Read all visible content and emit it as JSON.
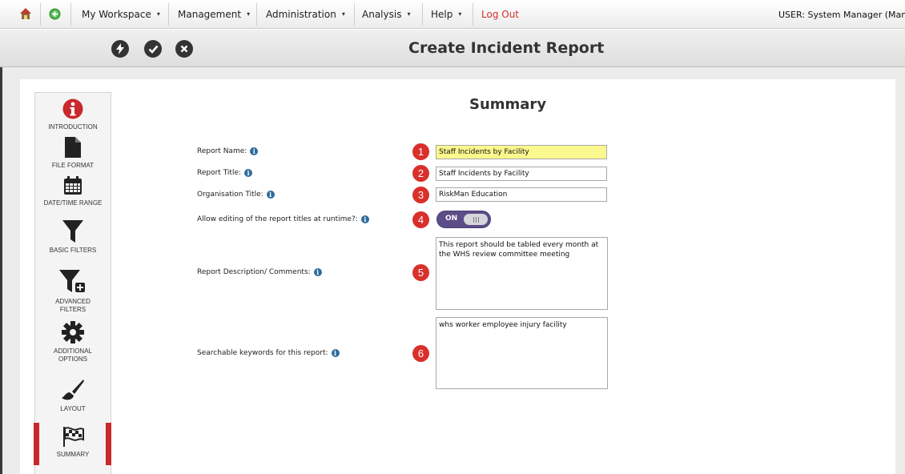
{
  "menu": {
    "items": [
      {
        "label": "My Workspace",
        "caret": "▾"
      },
      {
        "label": "Management",
        "caret": "▾"
      },
      {
        "label": "Administration",
        "caret": "▾"
      },
      {
        "label": "Analysis",
        "caret": "▾"
      },
      {
        "label": "Help",
        "caret": "▾"
      }
    ],
    "logout": "Log Out",
    "user": "USER: System Manager (Manager)"
  },
  "toolbar": {
    "title": "Create Incident Report",
    "buttons": [
      "lightning-icon",
      "check-icon",
      "close-icon"
    ]
  },
  "sidebar": {
    "items": [
      {
        "label": "INTRODUCTION",
        "icon": "info-icon"
      },
      {
        "label": "FILE FORMAT",
        "icon": "file-icon"
      },
      {
        "label": "DATE/TIME RANGE",
        "icon": "calendar-icon"
      },
      {
        "label": "BASIC FILTERS",
        "icon": "filter-icon"
      },
      {
        "label": "ADVANCED FILTERS",
        "icon": "filter-plus-icon"
      },
      {
        "label": "ADDITIONAL OPTIONS",
        "icon": "gear-icon"
      },
      {
        "label": "LAYOUT",
        "icon": "brush-icon"
      },
      {
        "label": "SUMMARY",
        "icon": "flag-checkered-icon",
        "active": true
      }
    ],
    "active_color": "#c9282d"
  },
  "summary": {
    "heading": "Summary",
    "fields": [
      {
        "label": "Report Name:",
        "marker": "1",
        "value": "Staff Incidents by Facility"
      },
      {
        "label": "Report Title:",
        "marker": "2",
        "value": "Staff Incidents by Facility"
      },
      {
        "label": "Organisation Title:",
        "marker": "3",
        "value": "RiskMan Education"
      },
      {
        "label": "Allow editing of the report titles at runtime?:",
        "marker": "4",
        "toggle_label": "ON",
        "toggle_on": true
      },
      {
        "label": "Report Description/ Comments:",
        "marker": "5",
        "value": "This report should be tabled every month at the WHS review committee meeting"
      },
      {
        "label": "Searchable keywords for this report:",
        "marker": "6",
        "value": "whs worker employee injury facility"
      }
    ],
    "info_glyph": "i"
  },
  "colors": {
    "marker": "#d9302b",
    "highlight": "#fbf88d",
    "toggle": "#5c4d88",
    "logout": "#d0312d"
  }
}
